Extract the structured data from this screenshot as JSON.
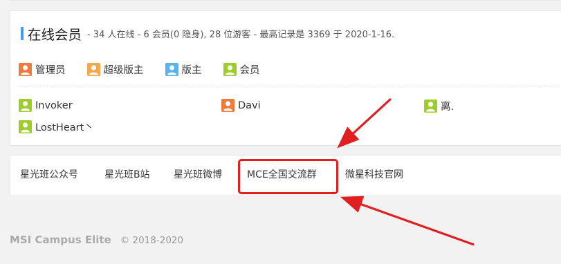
{
  "online": {
    "title": "在线会员",
    "stats": "- 34 人在线 - 6 会员(0 隐身), 28 位游客 - 最高记录是 3369 于 2020-1-16."
  },
  "legend": [
    {
      "label": "管理员",
      "color": "#f07a3c"
    },
    {
      "label": "超级版主",
      "color": "#f5a74c"
    },
    {
      "label": "版主",
      "color": "#58b3ec"
    },
    {
      "label": "会员",
      "color": "#9ccd2a"
    }
  ],
  "members": [
    {
      "name": "Invoker",
      "color": "#9ccd2a"
    },
    {
      "name": "Davi",
      "color": "#f07a3c"
    },
    {
      "name": "离.",
      "color": "#9ccd2a"
    },
    {
      "name": "LostHeart丶",
      "color": "#9ccd2a"
    }
  ],
  "links": [
    {
      "label": "星光班公众号"
    },
    {
      "label": "星光班B站"
    },
    {
      "label": "星光班微博"
    },
    {
      "label": "MCE全国交流群"
    },
    {
      "label": "微星科技官网"
    }
  ],
  "footer": {
    "brand": "MSI Campus Elite",
    "copyright": "© 2018-2020"
  },
  "colors": {
    "accent": "#3a9ff0",
    "annotation": "#e02020"
  }
}
